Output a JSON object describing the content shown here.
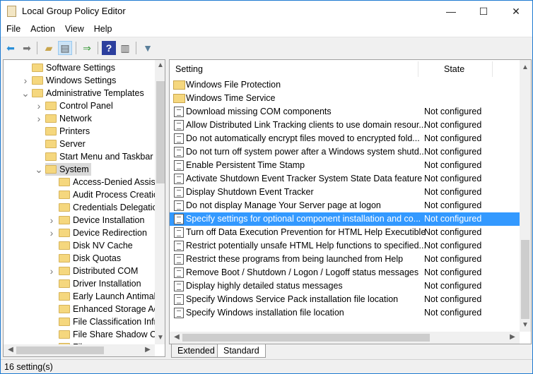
{
  "window": {
    "title": "Local Group Policy Editor",
    "minimize": "—",
    "maximize": "☐",
    "close": "✕"
  },
  "menu": [
    "File",
    "Action",
    "View",
    "Help"
  ],
  "toolbar": [
    "back-icon",
    "forward-icon",
    "up-folder-icon",
    "show-hide-tree-icon",
    "export-list-icon",
    "help-icon",
    "show-action-pane-icon",
    "filter-icon"
  ],
  "tree": [
    {
      "label": "Software Settings",
      "level": 0,
      "expander": ""
    },
    {
      "label": "Windows Settings",
      "level": 0,
      "expander": ">"
    },
    {
      "label": "Administrative Templates",
      "level": 0,
      "expander": "v",
      "open": true
    },
    {
      "label": "Control Panel",
      "level": 1,
      "expander": ">"
    },
    {
      "label": "Network",
      "level": 1,
      "expander": ">"
    },
    {
      "label": "Printers",
      "level": 1,
      "expander": ""
    },
    {
      "label": "Server",
      "level": 1,
      "expander": ""
    },
    {
      "label": "Start Menu and Taskbar",
      "level": 1,
      "expander": ""
    },
    {
      "label": "System",
      "level": 1,
      "expander": "v",
      "selected": true
    },
    {
      "label": "Access-Denied Assista",
      "level": 2,
      "expander": ""
    },
    {
      "label": "Audit Process Creatio",
      "level": 2,
      "expander": ""
    },
    {
      "label": "Credentials Delegatio",
      "level": 2,
      "expander": ""
    },
    {
      "label": "Device Installation",
      "level": 2,
      "expander": ">"
    },
    {
      "label": "Device Redirection",
      "level": 2,
      "expander": ">"
    },
    {
      "label": "Disk NV Cache",
      "level": 2,
      "expander": ""
    },
    {
      "label": "Disk Quotas",
      "level": 2,
      "expander": ""
    },
    {
      "label": "Distributed COM",
      "level": 2,
      "expander": ">"
    },
    {
      "label": "Driver Installation",
      "level": 2,
      "expander": ""
    },
    {
      "label": "Early Launch Antimal",
      "level": 2,
      "expander": ""
    },
    {
      "label": "Enhanced Storage Ac",
      "level": 2,
      "expander": ""
    },
    {
      "label": "File Classification Infr",
      "level": 2,
      "expander": ""
    },
    {
      "label": "File Share Shadow Co",
      "level": 2,
      "expander": ""
    },
    {
      "label": "File...",
      "level": 2,
      "expander": ""
    }
  ],
  "list": {
    "columns": {
      "setting": "Setting",
      "state": "State"
    },
    "rows": [
      {
        "name": "Windows File Protection",
        "state": "",
        "type": "folder"
      },
      {
        "name": "Windows Time Service",
        "state": "",
        "type": "folder"
      },
      {
        "name": "Download missing COM components",
        "state": "Not configured",
        "type": "policy"
      },
      {
        "name": "Allow Distributed Link Tracking clients to use domain resour...",
        "state": "Not configured",
        "type": "policy"
      },
      {
        "name": "Do not automatically encrypt files moved to encrypted fold...",
        "state": "Not configured",
        "type": "policy"
      },
      {
        "name": "Do not turn off system power after a Windows system shutd...",
        "state": "Not configured",
        "type": "policy"
      },
      {
        "name": "Enable Persistent Time Stamp",
        "state": "Not configured",
        "type": "policy"
      },
      {
        "name": "Activate Shutdown Event Tracker System State Data feature",
        "state": "Not configured",
        "type": "policy"
      },
      {
        "name": "Display Shutdown Event Tracker",
        "state": "Not configured",
        "type": "policy"
      },
      {
        "name": "Do not display Manage Your Server page at logon",
        "state": "Not configured",
        "type": "policy"
      },
      {
        "name": "Specify settings for optional component installation and co...",
        "state": "Not configured",
        "type": "policy",
        "selected": true
      },
      {
        "name": "Turn off Data Execution Prevention for HTML Help Executible",
        "state": "Not configured",
        "type": "policy"
      },
      {
        "name": "Restrict potentially unsafe HTML Help functions to specified...",
        "state": "Not configured",
        "type": "policy"
      },
      {
        "name": "Restrict these programs from being launched from Help",
        "state": "Not configured",
        "type": "policy"
      },
      {
        "name": "Remove Boot / Shutdown / Logon / Logoff status messages",
        "state": "Not configured",
        "type": "policy"
      },
      {
        "name": "Display highly detailed status messages",
        "state": "Not configured",
        "type": "policy"
      },
      {
        "name": "Specify Windows Service Pack installation file location",
        "state": "Not configured",
        "type": "policy"
      },
      {
        "name": "Specify Windows installation file location",
        "state": "Not configured",
        "type": "policy"
      }
    ]
  },
  "tabs": {
    "extended": "Extended",
    "standard": "Standard",
    "active": "Standard"
  },
  "status": "16 setting(s)",
  "colors": {
    "selection": "#3399ff",
    "folder": "#f5d77e"
  }
}
